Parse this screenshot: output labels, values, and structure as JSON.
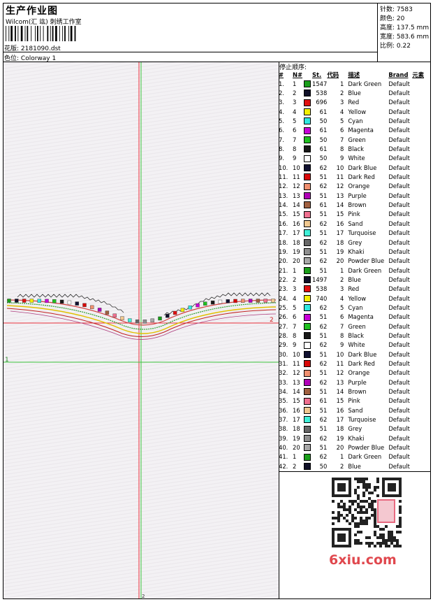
{
  "header": {
    "title": "生产作业图",
    "company": "Wilcom(汇 竑) 刺绣工作室",
    "design_label": "花版:",
    "design_file": "2181090.dst",
    "colorway_label": "色位:",
    "colorway": "Colorway 1"
  },
  "stats": [
    {
      "label": "针数:",
      "value": "7583"
    },
    {
      "label": "颜色:",
      "value": "20"
    },
    {
      "label": "高度:",
      "value": "137.5 mm"
    },
    {
      "label": "宽度:",
      "value": "583.6 mm"
    },
    {
      "label": "比例:",
      "value": "0.22"
    }
  ],
  "canvas": {
    "marker_left_1": "1",
    "marker_right_2": "2",
    "marker_bottom_2": "2",
    "colors": {
      "red_line": "#e8303a",
      "green_line": "#3bc23b"
    }
  },
  "stops": {
    "heading": "停止顺序:",
    "columns": {
      "idx": "#",
      "n": "N#",
      "st": "St.",
      "code": "代码",
      "desc": "描述",
      "brand": "Brand",
      "elem": "元素"
    },
    "rows": [
      {
        "idx": "1.",
        "n": "1",
        "color": "#1a9e1a",
        "st": "1547",
        "code": "1",
        "desc": "Dark Green",
        "brand": "Default"
      },
      {
        "idx": "2.",
        "n": "2",
        "color": "#101028",
        "st": "538",
        "code": "2",
        "desc": "Blue",
        "brand": "Default"
      },
      {
        "idx": "3.",
        "n": "3",
        "color": "#e01010",
        "st": "696",
        "code": "3",
        "desc": "Red",
        "brand": "Default"
      },
      {
        "idx": "4.",
        "n": "4",
        "color": "#f4f000",
        "st": "61",
        "code": "4",
        "desc": "Yellow",
        "brand": "Default"
      },
      {
        "idx": "5.",
        "n": "5",
        "color": "#30e8e0",
        "st": "50",
        "code": "5",
        "desc": "Cyan",
        "brand": "Default"
      },
      {
        "idx": "6.",
        "n": "6",
        "color": "#c800d8",
        "st": "61",
        "code": "6",
        "desc": "Magenta",
        "brand": "Default"
      },
      {
        "idx": "7.",
        "n": "7",
        "color": "#20c020",
        "st": "50",
        "code": "7",
        "desc": "Green",
        "brand": "Default"
      },
      {
        "idx": "8.",
        "n": "8",
        "color": "#181818",
        "st": "61",
        "code": "8",
        "desc": "Black",
        "brand": "Default"
      },
      {
        "idx": "9.",
        "n": "9",
        "color": "#ffffff",
        "st": "50",
        "code": "9",
        "desc": "White",
        "brand": "Default"
      },
      {
        "idx": "10.",
        "n": "10",
        "color": "#101030",
        "st": "62",
        "code": "10",
        "desc": "Dark Blue",
        "brand": "Default"
      },
      {
        "idx": "11.",
        "n": "11",
        "color": "#d80808",
        "st": "51",
        "code": "11",
        "desc": "Dark Red",
        "brand": "Default"
      },
      {
        "idx": "12.",
        "n": "12",
        "color": "#f09070",
        "st": "62",
        "code": "12",
        "desc": "Orange",
        "brand": "Default"
      },
      {
        "idx": "13.",
        "n": "13",
        "color": "#b000b8",
        "st": "51",
        "code": "13",
        "desc": "Purple",
        "brand": "Default"
      },
      {
        "idx": "14.",
        "n": "14",
        "color": "#a06040",
        "st": "61",
        "code": "14",
        "desc": "Brown",
        "brand": "Default"
      },
      {
        "idx": "15.",
        "n": "15",
        "color": "#f07090",
        "st": "51",
        "code": "15",
        "desc": "Pink",
        "brand": "Default"
      },
      {
        "idx": "16.",
        "n": "16",
        "color": "#f0c890",
        "st": "62",
        "code": "16",
        "desc": "Sand",
        "brand": "Default"
      },
      {
        "idx": "17.",
        "n": "17",
        "color": "#40f0d8",
        "st": "51",
        "code": "17",
        "desc": "Turquoise",
        "brand": "Default"
      },
      {
        "idx": "18.",
        "n": "18",
        "color": "#686868",
        "st": "62",
        "code": "18",
        "desc": "Grey",
        "brand": "Default"
      },
      {
        "idx": "19.",
        "n": "19",
        "color": "#909090",
        "st": "51",
        "code": "19",
        "desc": "Khaki",
        "brand": "Default"
      },
      {
        "idx": "20.",
        "n": "20",
        "color": "#a8a8a8",
        "st": "62",
        "code": "20",
        "desc": "Powder Blue",
        "brand": "Default"
      },
      {
        "idx": "21.",
        "n": "1",
        "color": "#1a9e1a",
        "st": "51",
        "code": "1",
        "desc": "Dark Green",
        "brand": "Default"
      },
      {
        "idx": "22.",
        "n": "2",
        "color": "#101028",
        "st": "1497",
        "code": "2",
        "desc": "Blue",
        "brand": "Default"
      },
      {
        "idx": "23.",
        "n": "3",
        "color": "#e01010",
        "st": "538",
        "code": "3",
        "desc": "Red",
        "brand": "Default"
      },
      {
        "idx": "24.",
        "n": "4",
        "color": "#f4f000",
        "st": "740",
        "code": "4",
        "desc": "Yellow",
        "brand": "Default"
      },
      {
        "idx": "25.",
        "n": "5",
        "color": "#30e8e0",
        "st": "62",
        "code": "5",
        "desc": "Cyan",
        "brand": "Default"
      },
      {
        "idx": "26.",
        "n": "6",
        "color": "#c800d8",
        "st": "51",
        "code": "6",
        "desc": "Magenta",
        "brand": "Default"
      },
      {
        "idx": "27.",
        "n": "7",
        "color": "#20c020",
        "st": "62",
        "code": "7",
        "desc": "Green",
        "brand": "Default"
      },
      {
        "idx": "28.",
        "n": "8",
        "color": "#181818",
        "st": "51",
        "code": "8",
        "desc": "Black",
        "brand": "Default"
      },
      {
        "idx": "29.",
        "n": "9",
        "color": "#ffffff",
        "st": "62",
        "code": "9",
        "desc": "White",
        "brand": "Default"
      },
      {
        "idx": "30.",
        "n": "10",
        "color": "#101030",
        "st": "51",
        "code": "10",
        "desc": "Dark Blue",
        "brand": "Default"
      },
      {
        "idx": "31.",
        "n": "11",
        "color": "#d80808",
        "st": "62",
        "code": "11",
        "desc": "Dark Red",
        "brand": "Default"
      },
      {
        "idx": "32.",
        "n": "12",
        "color": "#f09070",
        "st": "51",
        "code": "12",
        "desc": "Orange",
        "brand": "Default"
      },
      {
        "idx": "33.",
        "n": "13",
        "color": "#b000b8",
        "st": "62",
        "code": "13",
        "desc": "Purple",
        "brand": "Default"
      },
      {
        "idx": "34.",
        "n": "14",
        "color": "#a06040",
        "st": "51",
        "code": "14",
        "desc": "Brown",
        "brand": "Default"
      },
      {
        "idx": "35.",
        "n": "15",
        "color": "#f07090",
        "st": "61",
        "code": "15",
        "desc": "Pink",
        "brand": "Default"
      },
      {
        "idx": "36.",
        "n": "16",
        "color": "#f0c890",
        "st": "51",
        "code": "16",
        "desc": "Sand",
        "brand": "Default"
      },
      {
        "idx": "37.",
        "n": "17",
        "color": "#40f0d8",
        "st": "62",
        "code": "17",
        "desc": "Turquoise",
        "brand": "Default"
      },
      {
        "idx": "38.",
        "n": "18",
        "color": "#686868",
        "st": "51",
        "code": "18",
        "desc": "Grey",
        "brand": "Default"
      },
      {
        "idx": "39.",
        "n": "19",
        "color": "#909090",
        "st": "62",
        "code": "19",
        "desc": "Khaki",
        "brand": "Default"
      },
      {
        "idx": "40.",
        "n": "20",
        "color": "#a8a8a8",
        "st": "51",
        "code": "20",
        "desc": "Powder Blue",
        "brand": "Default"
      },
      {
        "idx": "41.",
        "n": "1",
        "color": "#1a9e1a",
        "st": "62",
        "code": "1",
        "desc": "Dark Green",
        "brand": "Default"
      },
      {
        "idx": "42.",
        "n": "2",
        "color": "#101028",
        "st": "50",
        "code": "2",
        "desc": "Blue",
        "brand": "Default"
      }
    ]
  },
  "watermark": {
    "site": "6xiu.com",
    "colors": {
      "site": "#e0484e",
      "seal": "#e86a80"
    }
  }
}
